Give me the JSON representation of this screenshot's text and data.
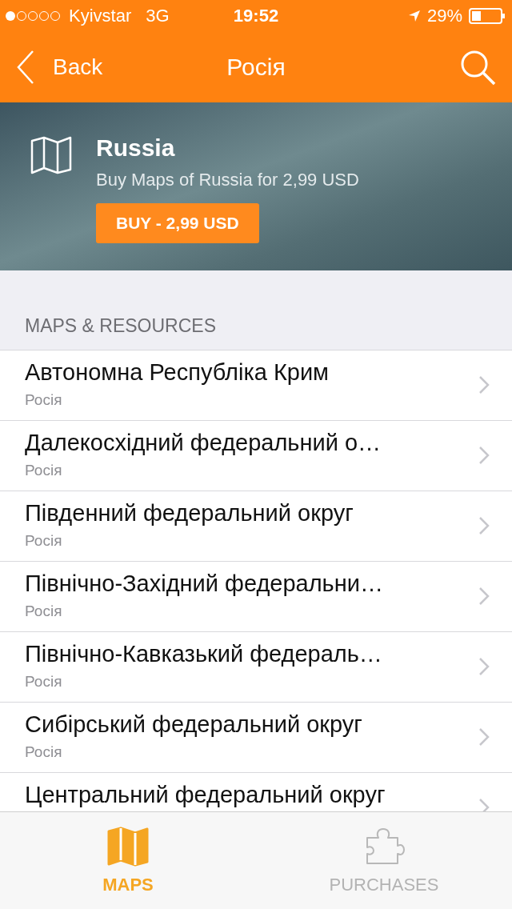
{
  "status_bar": {
    "carrier": "Kyivstar",
    "network": "3G",
    "time": "19:52",
    "battery": "29%"
  },
  "nav": {
    "back": "Back",
    "title": "Росія"
  },
  "header": {
    "title": "Russia",
    "subtitle": "Buy Maps of Russia for 2,99 USD",
    "buy_button": "BUY - 2,99 USD"
  },
  "section_title": "MAPS & RESOURCES",
  "items": [
    {
      "title": "Автономна Республіка Крим",
      "subtitle": "Росія"
    },
    {
      "title": "Далекосхідний федеральний о…",
      "subtitle": "Росія"
    },
    {
      "title": "Південний федеральний округ",
      "subtitle": "Росія"
    },
    {
      "title": "Північно-Західний федеральни…",
      "subtitle": "Росія"
    },
    {
      "title": "Північно-Кавказький федераль…",
      "subtitle": "Росія"
    },
    {
      "title": "Сибірський федеральний округ",
      "subtitle": "Росія"
    },
    {
      "title": "Центральний федеральний округ"
    }
  ],
  "tabs": [
    {
      "kind": "map",
      "label": "MAPS",
      "selected": true
    },
    {
      "kind": "puzzle",
      "label": "PURCHASES",
      "selected": false
    }
  ]
}
